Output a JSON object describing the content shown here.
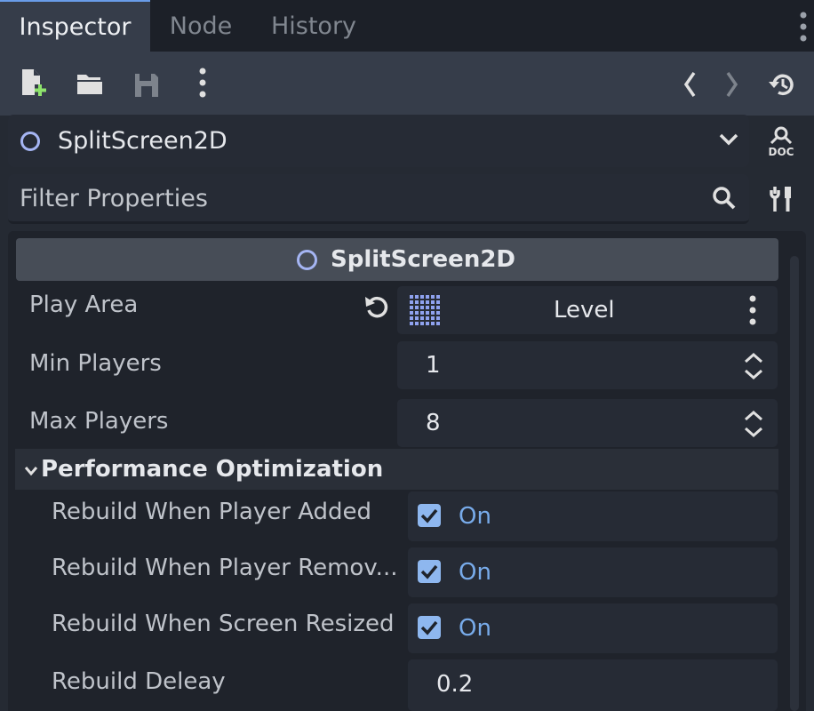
{
  "tabs": [
    {
      "label": "Inspector",
      "active": true
    },
    {
      "label": "Node",
      "active": false
    },
    {
      "label": "History",
      "active": false
    }
  ],
  "toolbar": {
    "icons": [
      "new-resource-icon",
      "open-folder-icon",
      "save-icon",
      "more-icon",
      "back-icon",
      "forward-icon",
      "history-icon"
    ]
  },
  "object": {
    "name": "SplitScreen2D",
    "doc_label": "DOC"
  },
  "filter": {
    "placeholder": "Filter Properties"
  },
  "inspector": {
    "header_title": "SplitScreen2D",
    "properties": [
      {
        "label": "Play Area",
        "value": "Level"
      },
      {
        "label": "Min Players",
        "value": "1"
      },
      {
        "label": "Max Players",
        "value": "8"
      }
    ],
    "section_title": "Performance Optimization",
    "section_props": [
      {
        "label": "Rebuild When Player Added",
        "value": "On"
      },
      {
        "label": "Rebuild When Player Remov...",
        "value": "On"
      },
      {
        "label": "Rebuild When Screen Resized",
        "value": "On"
      },
      {
        "label": "Rebuild Deleay",
        "value": "0.2"
      }
    ]
  },
  "colors": {
    "accent": "#699ce8",
    "node_icon": "#a5b5f3",
    "checkbox": "#8eb7ef",
    "on_text": "#78abea"
  }
}
